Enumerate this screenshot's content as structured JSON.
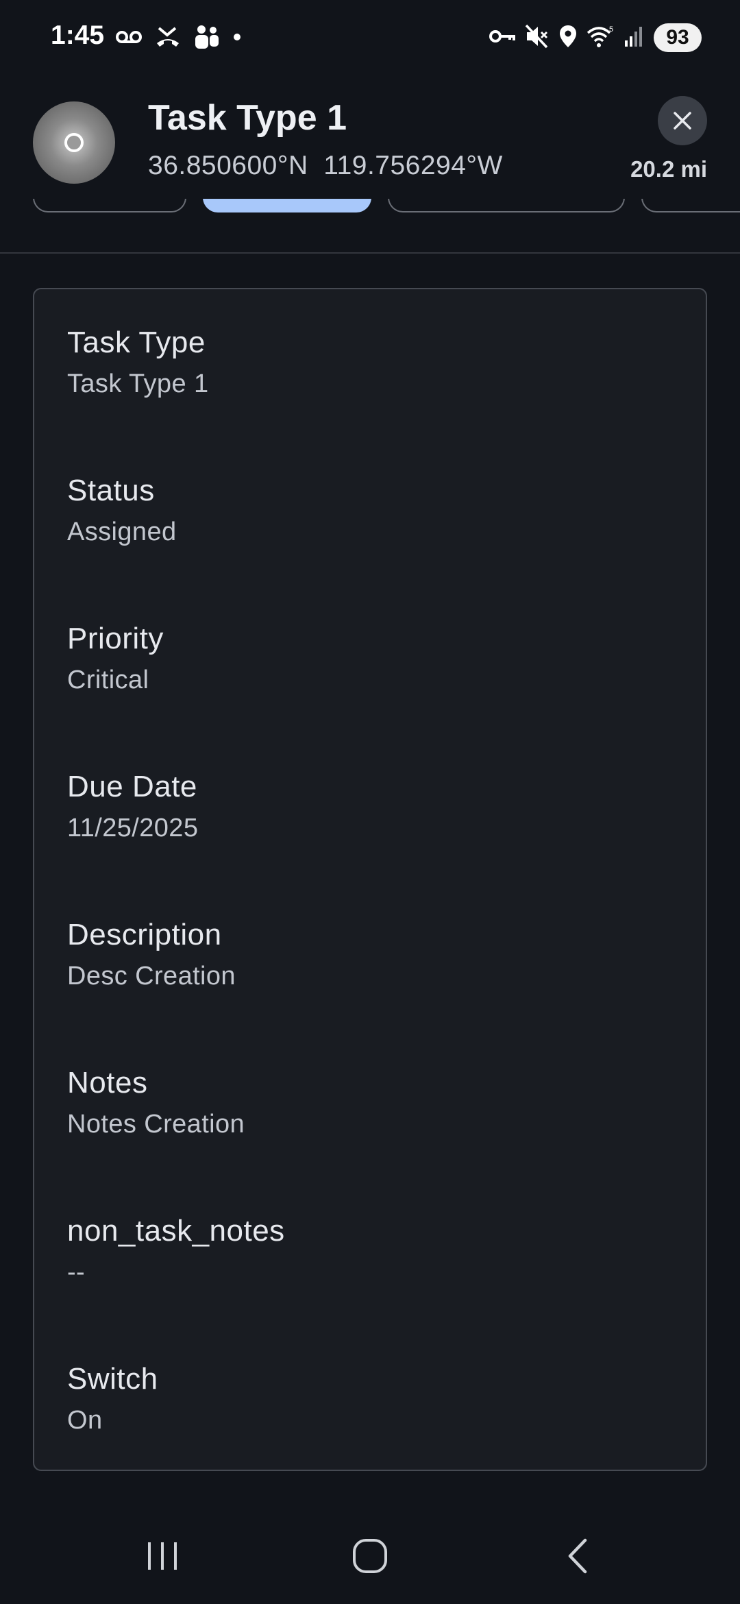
{
  "status_bar": {
    "time": "1:45",
    "battery": "93",
    "left_icons": [
      "voicemail-icon",
      "missed-call-icon",
      "teams-icon",
      "dot-icon"
    ],
    "right_icons": [
      "vpn-key-icon",
      "mute-icon",
      "location-icon",
      "wifi-icon",
      "signal-icon"
    ]
  },
  "header": {
    "title": "Task Type 1",
    "coordinates": "36.850600°N  119.756294°W",
    "distance": "20.2 mi"
  },
  "tabs": {
    "count": 4,
    "active_index": 1
  },
  "details": {
    "fields": [
      {
        "label": "Task Type",
        "value": "Task Type 1"
      },
      {
        "label": "Status",
        "value": "Assigned"
      },
      {
        "label": "Priority",
        "value": "Critical"
      },
      {
        "label": "Due Date",
        "value": "11/25/2025"
      },
      {
        "label": "Description",
        "value": "Desc Creation"
      },
      {
        "label": "Notes",
        "value": "Notes Creation"
      },
      {
        "label": "non_task_notes",
        "value": "--"
      },
      {
        "label": "Switch",
        "value": "On"
      }
    ]
  },
  "colors": {
    "background": "#11141a",
    "card": "#191c22",
    "accent_tab": "#a8c8fa"
  },
  "nav_bar": {
    "buttons": [
      "recents-icon",
      "home-icon",
      "back-icon"
    ]
  }
}
